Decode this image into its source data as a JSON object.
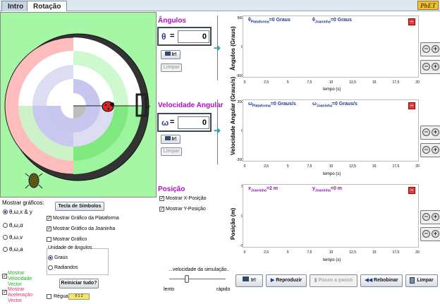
{
  "tabs": [
    "Intro",
    "Rotação"
  ],
  "logo": "PhET",
  "angles": {
    "title": "Ângulos",
    "symbol": "θ",
    "value": "0",
    "ref_btn": "Ir!",
    "clear_btn": "Limpar"
  },
  "velocity": {
    "title": "Velocidade Angular",
    "symbol": "ω",
    "value": "0",
    "ref_btn": "Ir!",
    "clear_btn": "Limpar"
  },
  "position": {
    "title": "Posição",
    "show_x": "Mostrar X-Posição",
    "show_y": "Mostrar Y-Posição"
  },
  "charts": {
    "angles": {
      "ylabel": "Ângulos (Graus)",
      "xlabel": "tempo (s)",
      "yticks": [
        "500",
        "0",
        "-500"
      ],
      "readout1_main": "θ",
      "readout1_sub": "Plataforma",
      "readout1_val": "=0 Graus",
      "readout2_main": "θ",
      "readout2_sub": "Joaninha",
      "readout2_val": "=0 Graus"
    },
    "velocity": {
      "ylabel": "Velocidade Angular (Graus/s)",
      "xlabel": "tempo (s)",
      "yticks": [
        "200",
        "0",
        "-200"
      ],
      "readout1_main": "ω",
      "readout1_sub": "Plataforma",
      "readout1_val": "=0 Graus/s",
      "readout2_main": "ω",
      "readout2_sub": "Joaninha",
      "readout2_val": "=0 Graus/s"
    },
    "position": {
      "ylabel": "Posição (m)",
      "xlabel": "tempo (s)",
      "yticks": [
        "5",
        "0",
        "-5"
      ],
      "readout1_main": "x",
      "readout1_sub": "Joaninha",
      "readout1_val": "=2 m",
      "readout2_main": "y",
      "readout2_sub": "Joaninha",
      "readout2_val": "=0 m"
    },
    "xticks": [
      "0",
      "2,5",
      "5",
      "7,5",
      "10",
      "12,5",
      "15",
      "17,5",
      "20"
    ]
  },
  "controls": {
    "show_graphs": "Mostrar gráficos:",
    "symbols_btn": "Tecla de Símbolos",
    "g1": "θ,ω,x & y",
    "g2": "θ,ω,α",
    "g3": "θ,ω,v",
    "g4": "θ,ω,a",
    "cb_platform": "Mostrar Gráfico da Plataforma",
    "cb_ladybug": "Mostrar Gráfico da Joaninha",
    "cb_graph": "Mostrar Gráfico",
    "units_title": "Unidade de ângulos",
    "deg": "Graus",
    "rad": "Radiandos",
    "vel_vec": "Mostrar Velocidade Vector",
    "acc_vec": "Mostrar Aceleração Vector",
    "reset": "Reiniciar tudo?",
    "ruler": "Régua",
    "ruler_ticks": "0 1 2",
    "sim_speed": "...velocidade da simulação..",
    "slow": "lento",
    "fast": "rápido"
  },
  "playback": {
    "go": "Ir!",
    "play": "Reproduzir",
    "step": "Passo a passo",
    "rewind": "Rebobinar",
    "clear": "Limpar"
  },
  "colors": {
    "accent": "#b30cc8",
    "platform_green": "#a5f7a5"
  }
}
